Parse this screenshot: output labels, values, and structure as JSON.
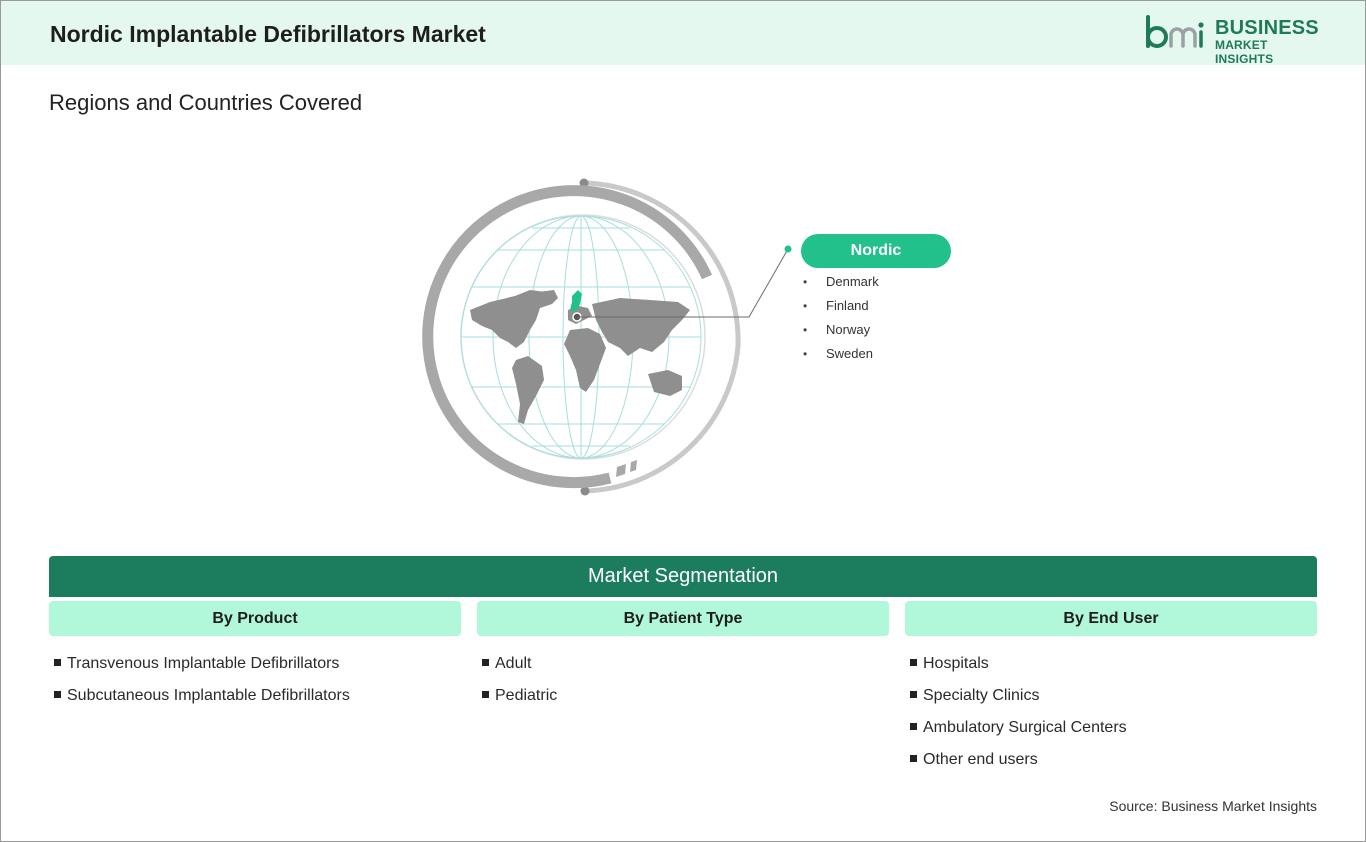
{
  "header": {
    "title": "Nordic Implantable Defibrillators Market",
    "logo": {
      "icon": "bmi-logo-icon",
      "line1": "BUSINESS",
      "line2": "MARKET INSIGHTS",
      "color": "#1f7a57"
    }
  },
  "regions": {
    "heading": "Regions and Countries Covered",
    "region_label": "Nordic",
    "countries": [
      "Denmark",
      "Finland",
      "Norway",
      "Sweden"
    ],
    "accent": "#22c08a"
  },
  "segmentation": {
    "title": "Market Segmentation",
    "columns": [
      {
        "heading": "By Product",
        "items": [
          "Transvenous Implantable Defibrillators",
          "Subcutaneous Implantable Defibrillators"
        ]
      },
      {
        "heading": "By Patient Type",
        "items": [
          "Adult",
          "Pediatric"
        ]
      },
      {
        "heading": "By End User",
        "items": [
          "Hospitals",
          "Specialty Clinics",
          "Ambulatory Surgical Centers",
          "Other end users"
        ]
      }
    ],
    "bar_color": "#1c7d5e",
    "header_color": "#b1f7da"
  },
  "footer": {
    "source": "Source: Business Market Insights"
  }
}
